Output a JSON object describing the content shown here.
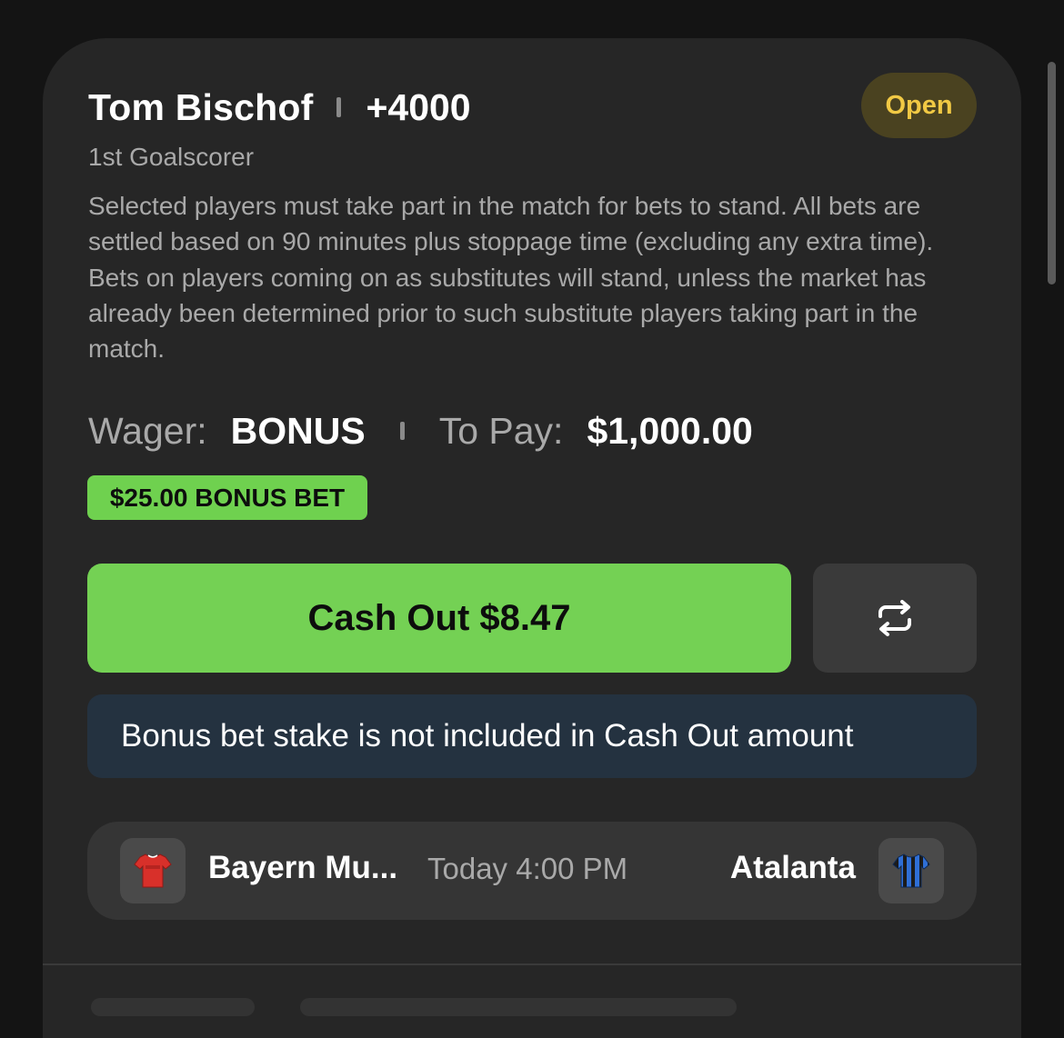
{
  "bet": {
    "player": "Tom Bischof",
    "odds": "+4000",
    "status": "Open",
    "market": "1st Goalscorer",
    "rules": "Selected players must take part in the match for bets to stand. All bets are settled based on 90 minutes plus stoppage time (excluding any extra time). Bets on players coming on as substitutes will stand, unless the market has already been determined prior to such substitute players taking part in the match."
  },
  "wager": {
    "label": "Wager:",
    "value": "BONUS",
    "to_pay_label": "To Pay:",
    "to_pay_value": "$1,000.00"
  },
  "bonus_badge": "$25.00 BONUS BET",
  "cashout": {
    "label": "Cash Out $8.47",
    "repeat_icon": "repeat-icon"
  },
  "info_banner": "Bonus bet stake is not included in Cash Out amount",
  "match": {
    "home_team": "Bayern Mu...",
    "home_jersey_icon": "red-jersey-icon",
    "time": "Today 4:00 PM",
    "away_team": "Atalanta",
    "away_jersey_icon": "blue-black-striped-jersey-icon"
  },
  "colors": {
    "accent_green": "#74d154",
    "status_yellow": "#f1c944",
    "banner_bg": "#243240",
    "card_bg": "#262626"
  }
}
